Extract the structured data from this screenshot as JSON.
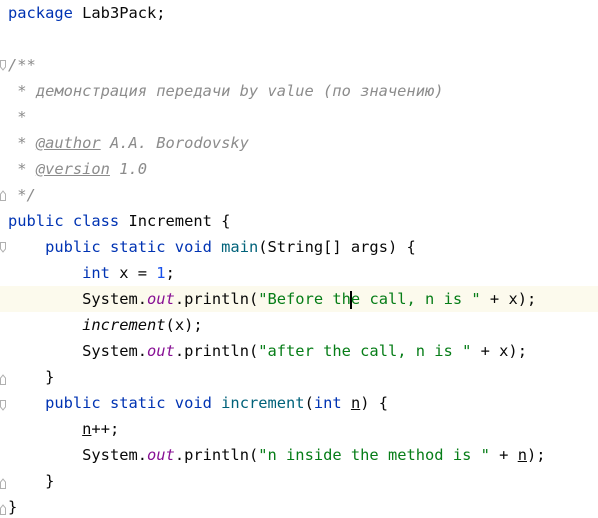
{
  "code": {
    "package_kw": "package",
    "package_name": " Lab3Pack;",
    "doc_open": "/**",
    "doc_line1": " * демонстрация передачи by value (по значению)",
    "doc_star": " *",
    "doc_author_prefix": " * ",
    "doc_author_tag": "@author",
    "doc_author_text": " A.A. Borodovsky",
    "doc_version_prefix": " * ",
    "doc_version_tag": "@version",
    "doc_version_text": " 1.0",
    "doc_close": " */",
    "class_decl": {
      "kw": "public class",
      "name": " Increment {"
    },
    "main_decl": {
      "indent": "    ",
      "kw": "public static void",
      "space": " ",
      "name": "main",
      "params": "(String[] args) {"
    },
    "int_decl": {
      "indent": "        ",
      "kw": "int",
      "mid": " x = ",
      "num": "1",
      "end": ";"
    },
    "println1": {
      "indent": "        ",
      "sys": "System.",
      "out": "out",
      "call": ".println(",
      "str_a": "\"Before th",
      "str_b": "e call, n is \"",
      "end": " + x);"
    },
    "increment_call": {
      "indent": "        ",
      "name": "increment",
      "args": "(x);"
    },
    "println2": {
      "indent": "        ",
      "sys": "System.",
      "out": "out",
      "call": ".println(",
      "str": "\"after the call, n is \"",
      "end": " + x);"
    },
    "close_main": "    }",
    "inc_decl": {
      "indent": "    ",
      "kw": "public static void",
      "space": " ",
      "name": "increment",
      "open": "(",
      "kw2": "int",
      "space2": " ",
      "param": "n",
      "end": ") {"
    },
    "nplusplus": {
      "indent": "        ",
      "var": "n",
      "op": "++;"
    },
    "println3": {
      "indent": "        ",
      "sys": "System.",
      "out": "out",
      "call": ".println(",
      "str": "\"n inside the method is \"",
      "mid": " + ",
      "var": "n",
      "end": ");"
    },
    "close_inc": "    }",
    "close_class": "}"
  }
}
